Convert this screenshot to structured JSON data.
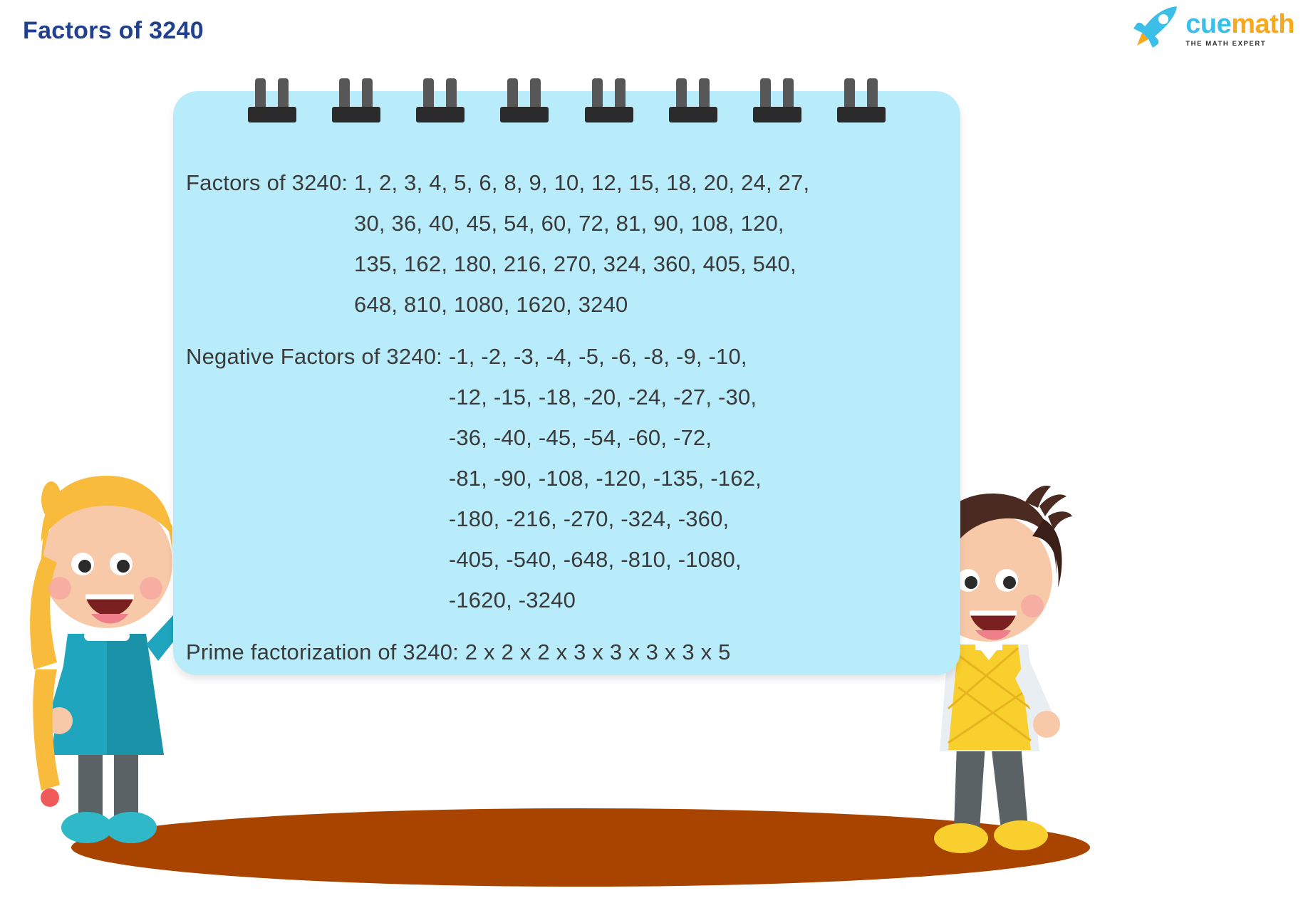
{
  "header": {
    "title": "Factors of 3240",
    "title_color": "#21418f",
    "logo": {
      "icon": "rocket-icon",
      "word_primary": "cue",
      "word_secondary": "math",
      "primary_color": "#3bbfe8",
      "secondary_color": "#f8a81b",
      "tagline": "THE MATH EXPERT"
    }
  },
  "notepad": {
    "background_color": "#b9ecfb",
    "spiral_count": 8,
    "sections": [
      {
        "id": "factors",
        "label": "Factors of 3240:",
        "lines": [
          "1, 2, 3, 4, 5, 6, 8, 9, 10, 12, 15, 18, 20, 24, 27,",
          "30, 36, 40, 45, 54, 60, 72, 81, 90, 108, 120,",
          "135, 162, 180, 216, 270, 324, 360, 405, 540,",
          "648, 810, 1080, 1620, 3240"
        ]
      },
      {
        "id": "negative-factors",
        "label": "Negative Factors of 3240:",
        "lines": [
          "-1, -2, -3, -4, -5, -6, -8, -9, -10,",
          "-12, -15, -18, -20, -24, -27, -30,",
          "-36, -40, -45, -54, -60, -72,",
          "-81, -90, -108, -120, -135, -162,",
          "-180, -216, -270, -324, -360,",
          "-405, -540, -648, -810, -1080,",
          "-1620, -3240"
        ]
      },
      {
        "id": "prime-factorization",
        "label": "Prime factorization of 3240:",
        "lines": [
          "2 x 2 x 2 x 3 x 3 x 3 x 3 x 5"
        ]
      }
    ]
  },
  "characters": [
    {
      "id": "girl",
      "name": "girl-character",
      "hair_color": "#f9bb3c",
      "shirt_color": "#1fa5bd"
    },
    {
      "id": "boy",
      "name": "boy-character",
      "hair_color": "#4b2a22",
      "shirt_color": "#f9cf2e"
    }
  ],
  "ground_color": "#a84400"
}
